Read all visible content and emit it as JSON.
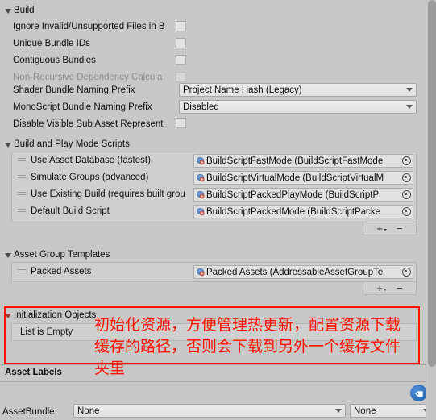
{
  "sections": {
    "build": {
      "title": "Build",
      "rows": [
        {
          "label": "Ignore Invalid/Unsupported Files in B",
          "control": "checkbox",
          "checked": false,
          "disabled": false
        },
        {
          "label": "Unique Bundle IDs",
          "control": "checkbox",
          "checked": false,
          "disabled": false
        },
        {
          "label": "Contiguous Bundles",
          "control": "checkbox",
          "checked": false,
          "disabled": false
        },
        {
          "label": "Non-Recursive Dependency Calcula",
          "control": "checkbox",
          "checked": false,
          "disabled": true
        },
        {
          "label": "Shader Bundle Naming Prefix",
          "control": "dropdown",
          "value": "Project Name Hash (Legacy)"
        },
        {
          "label": "MonoScript Bundle Naming Prefix",
          "control": "dropdown",
          "value": "Disabled"
        },
        {
          "label": "Disable Visible Sub Asset Represent",
          "control": "checkbox",
          "checked": false,
          "disabled": false
        }
      ]
    },
    "build_play_mode_scripts": {
      "title": "Build and Play Mode Scripts",
      "items": [
        {
          "label": "Use Asset Database (fastest)",
          "object_value": "BuildScriptFastMode (BuildScriptFastMode"
        },
        {
          "label": "Simulate Groups (advanced)",
          "object_value": "BuildScriptVirtualMode (BuildScriptVirtualM"
        },
        {
          "label": "Use Existing Build (requires built grou",
          "object_value": "BuildScriptPackedPlayMode (BuildScriptP"
        },
        {
          "label": "Default Build Script",
          "object_value": "BuildScriptPackedMode (BuildScriptPacke"
        }
      ],
      "add_label": "+",
      "remove_label": "−"
    },
    "asset_group_templates": {
      "title": "Asset Group Templates",
      "items": [
        {
          "label": "Packed Assets",
          "object_value": "Packed Assets (AddressableAssetGroupTe"
        }
      ],
      "add_label": "+",
      "remove_label": "−"
    },
    "initialization_objects": {
      "title": "Initialization Objects",
      "empty_label": "List is Empty"
    }
  },
  "annotation": {
    "line1": "初始化资源，方便管理热更新，配置资源下载",
    "line2": "缓存的路径，否则会下载到另外一个缓存文件",
    "line3": "夹里",
    "color": "#fe1200"
  },
  "bottom": {
    "asset_labels_title": "Asset Labels",
    "tag_icon": "tag-icon",
    "assetbundle_label": "AssetBundle",
    "assetbundle_value": "None",
    "assetbundle_variant_value": "None"
  },
  "scrollbar": {
    "name": "vertical-scrollbar"
  }
}
